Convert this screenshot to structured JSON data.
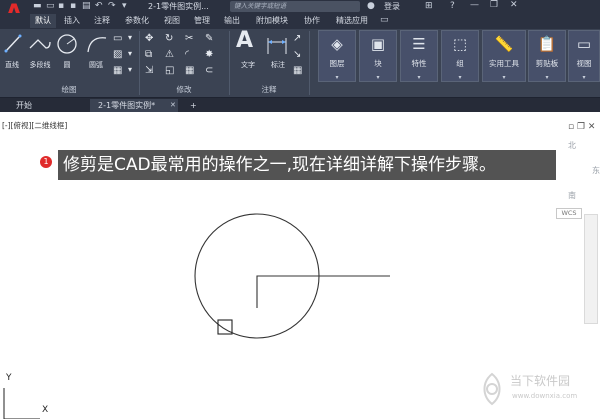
{
  "app": {
    "logo_letter": "A",
    "document_title": "2-1零件图实例...",
    "search_placeholder": "键入关键字或短语",
    "login_label": "登录"
  },
  "menu": {
    "items": [
      "默认",
      "插入",
      "注释",
      "参数化",
      "视图",
      "管理",
      "输出",
      "附加模块",
      "协作",
      "精选应用"
    ],
    "active_index": 0
  },
  "ribbon": {
    "draw": {
      "line": "直线",
      "polyline": "多段线",
      "circle": "圆",
      "arc": "圆弧",
      "panel_label": "绘图"
    },
    "modify": {
      "panel_label": "修改"
    },
    "annotation": {
      "text": "文字",
      "dimension": "标注",
      "panel_label": "注释"
    },
    "buttons": [
      "图层",
      "块",
      "特性",
      "组",
      "实用工具",
      "剪贴板",
      "视图"
    ]
  },
  "doc_tabs": {
    "start": "开始",
    "file": "2-1零件图实例*",
    "add": "+"
  },
  "viewport": {
    "label": "[-][俯视][二维线框]",
    "compass_north": "北",
    "compass_east": "东",
    "compass_south": "南",
    "wcs": "WCS",
    "ucs_y": "Y",
    "ucs_x": "X"
  },
  "tutorial": {
    "step_number": "1",
    "caption": "修剪是CAD最常用的操作之一,现在详细详解下操作步骤。"
  },
  "watermark": {
    "name": "当下软件园",
    "url": "www.downxia.com"
  },
  "colors": {
    "ribbon_bg": "#3b4353",
    "title_bg": "#2b3140",
    "logo_red": "#e32a2a",
    "badge_red": "#e02b2b",
    "banner_bg": "#464646"
  }
}
